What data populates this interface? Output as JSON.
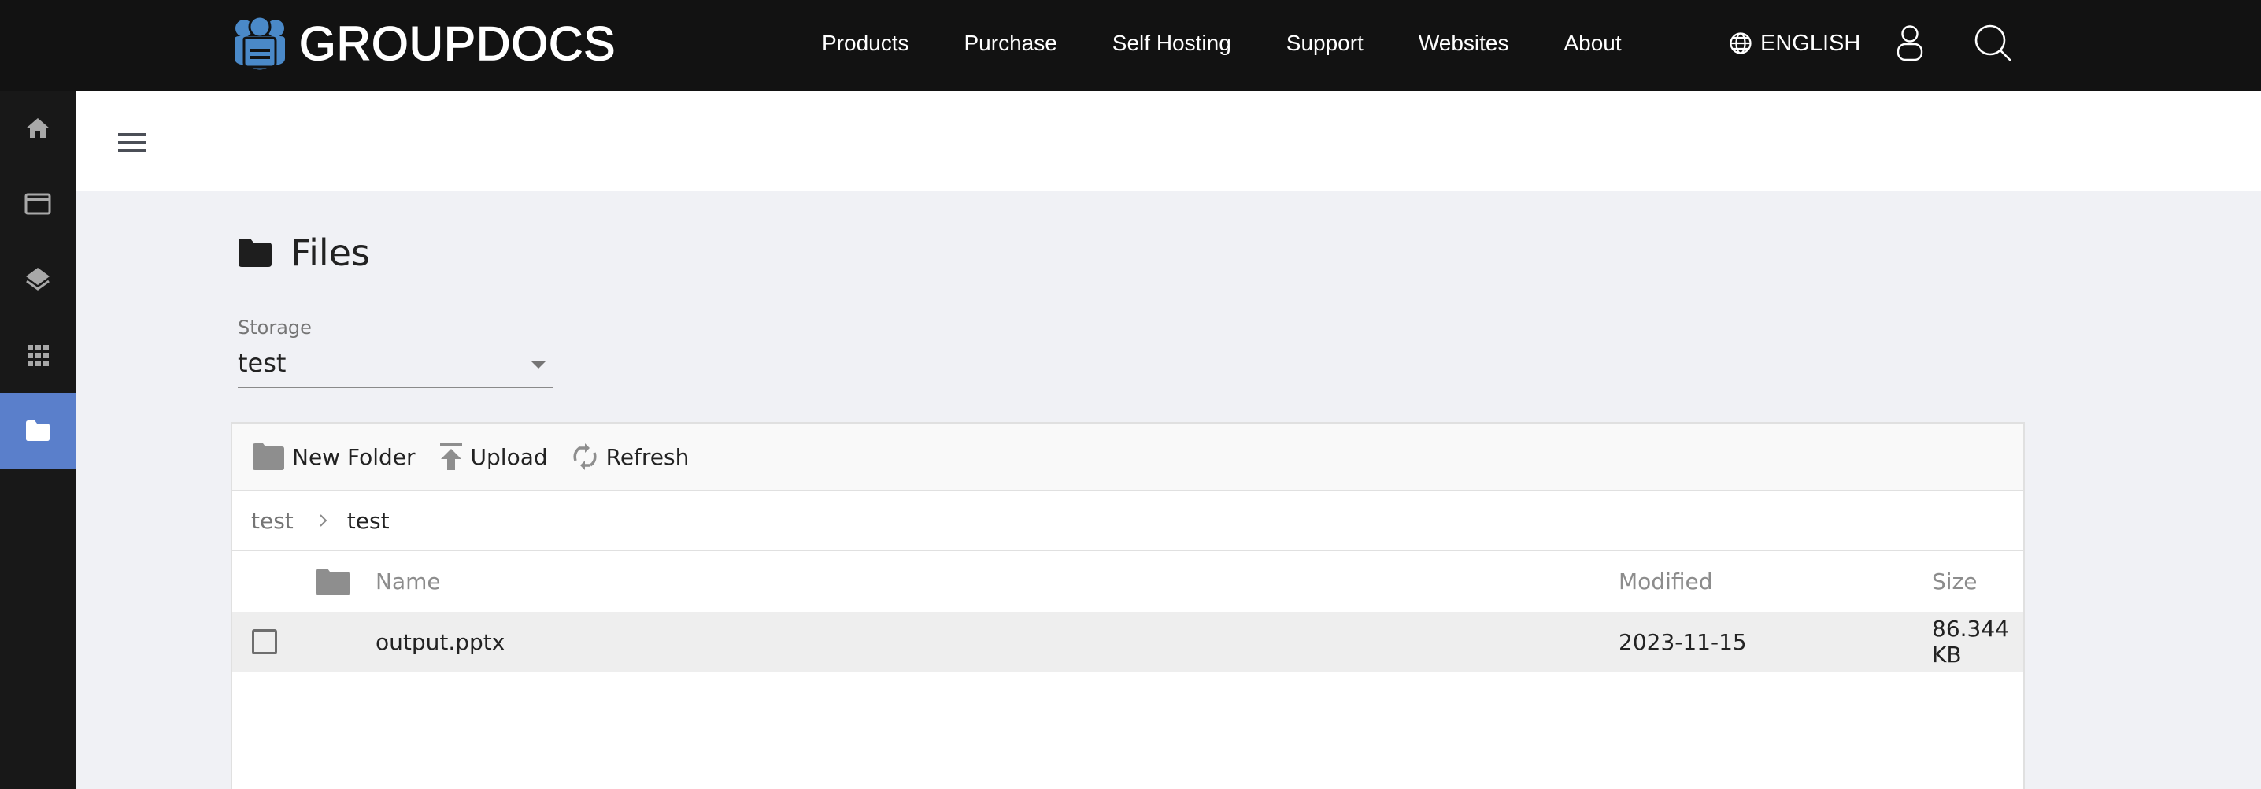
{
  "topnav": {
    "brand": "GROUPDOCS",
    "brand_color": "#4a89c8",
    "links": [
      "Products",
      "Purchase",
      "Self Hosting",
      "Support",
      "Websites",
      "About"
    ],
    "language": "ENGLISH",
    "icons": {
      "language": "globe-icon",
      "user": "user-icon",
      "search": "search-icon"
    }
  },
  "sidebar": {
    "items": [
      {
        "icon": "home-icon",
        "active": false
      },
      {
        "icon": "credit-card-icon",
        "active": false
      },
      {
        "icon": "layers-icon",
        "active": false
      },
      {
        "icon": "apps-grid-icon",
        "active": false
      },
      {
        "icon": "folder-icon",
        "active": true
      }
    ],
    "active_color": "#5a7fcb"
  },
  "subheader": {
    "menu_icon": "hamburger-icon"
  },
  "page": {
    "title": "Files",
    "title_icon": "folder-icon"
  },
  "storage": {
    "label": "Storage",
    "value": "test"
  },
  "toolbar": {
    "new_folder": "New Folder",
    "upload": "Upload",
    "refresh": "Refresh"
  },
  "breadcrumb": {
    "items": [
      "test",
      "test"
    ]
  },
  "table": {
    "columns": [
      "Name",
      "Modified",
      "Size"
    ],
    "rows": [
      {
        "name": "output.pptx",
        "modified": "2023-11-15",
        "size": "86.344 KB",
        "checked": false
      }
    ]
  }
}
